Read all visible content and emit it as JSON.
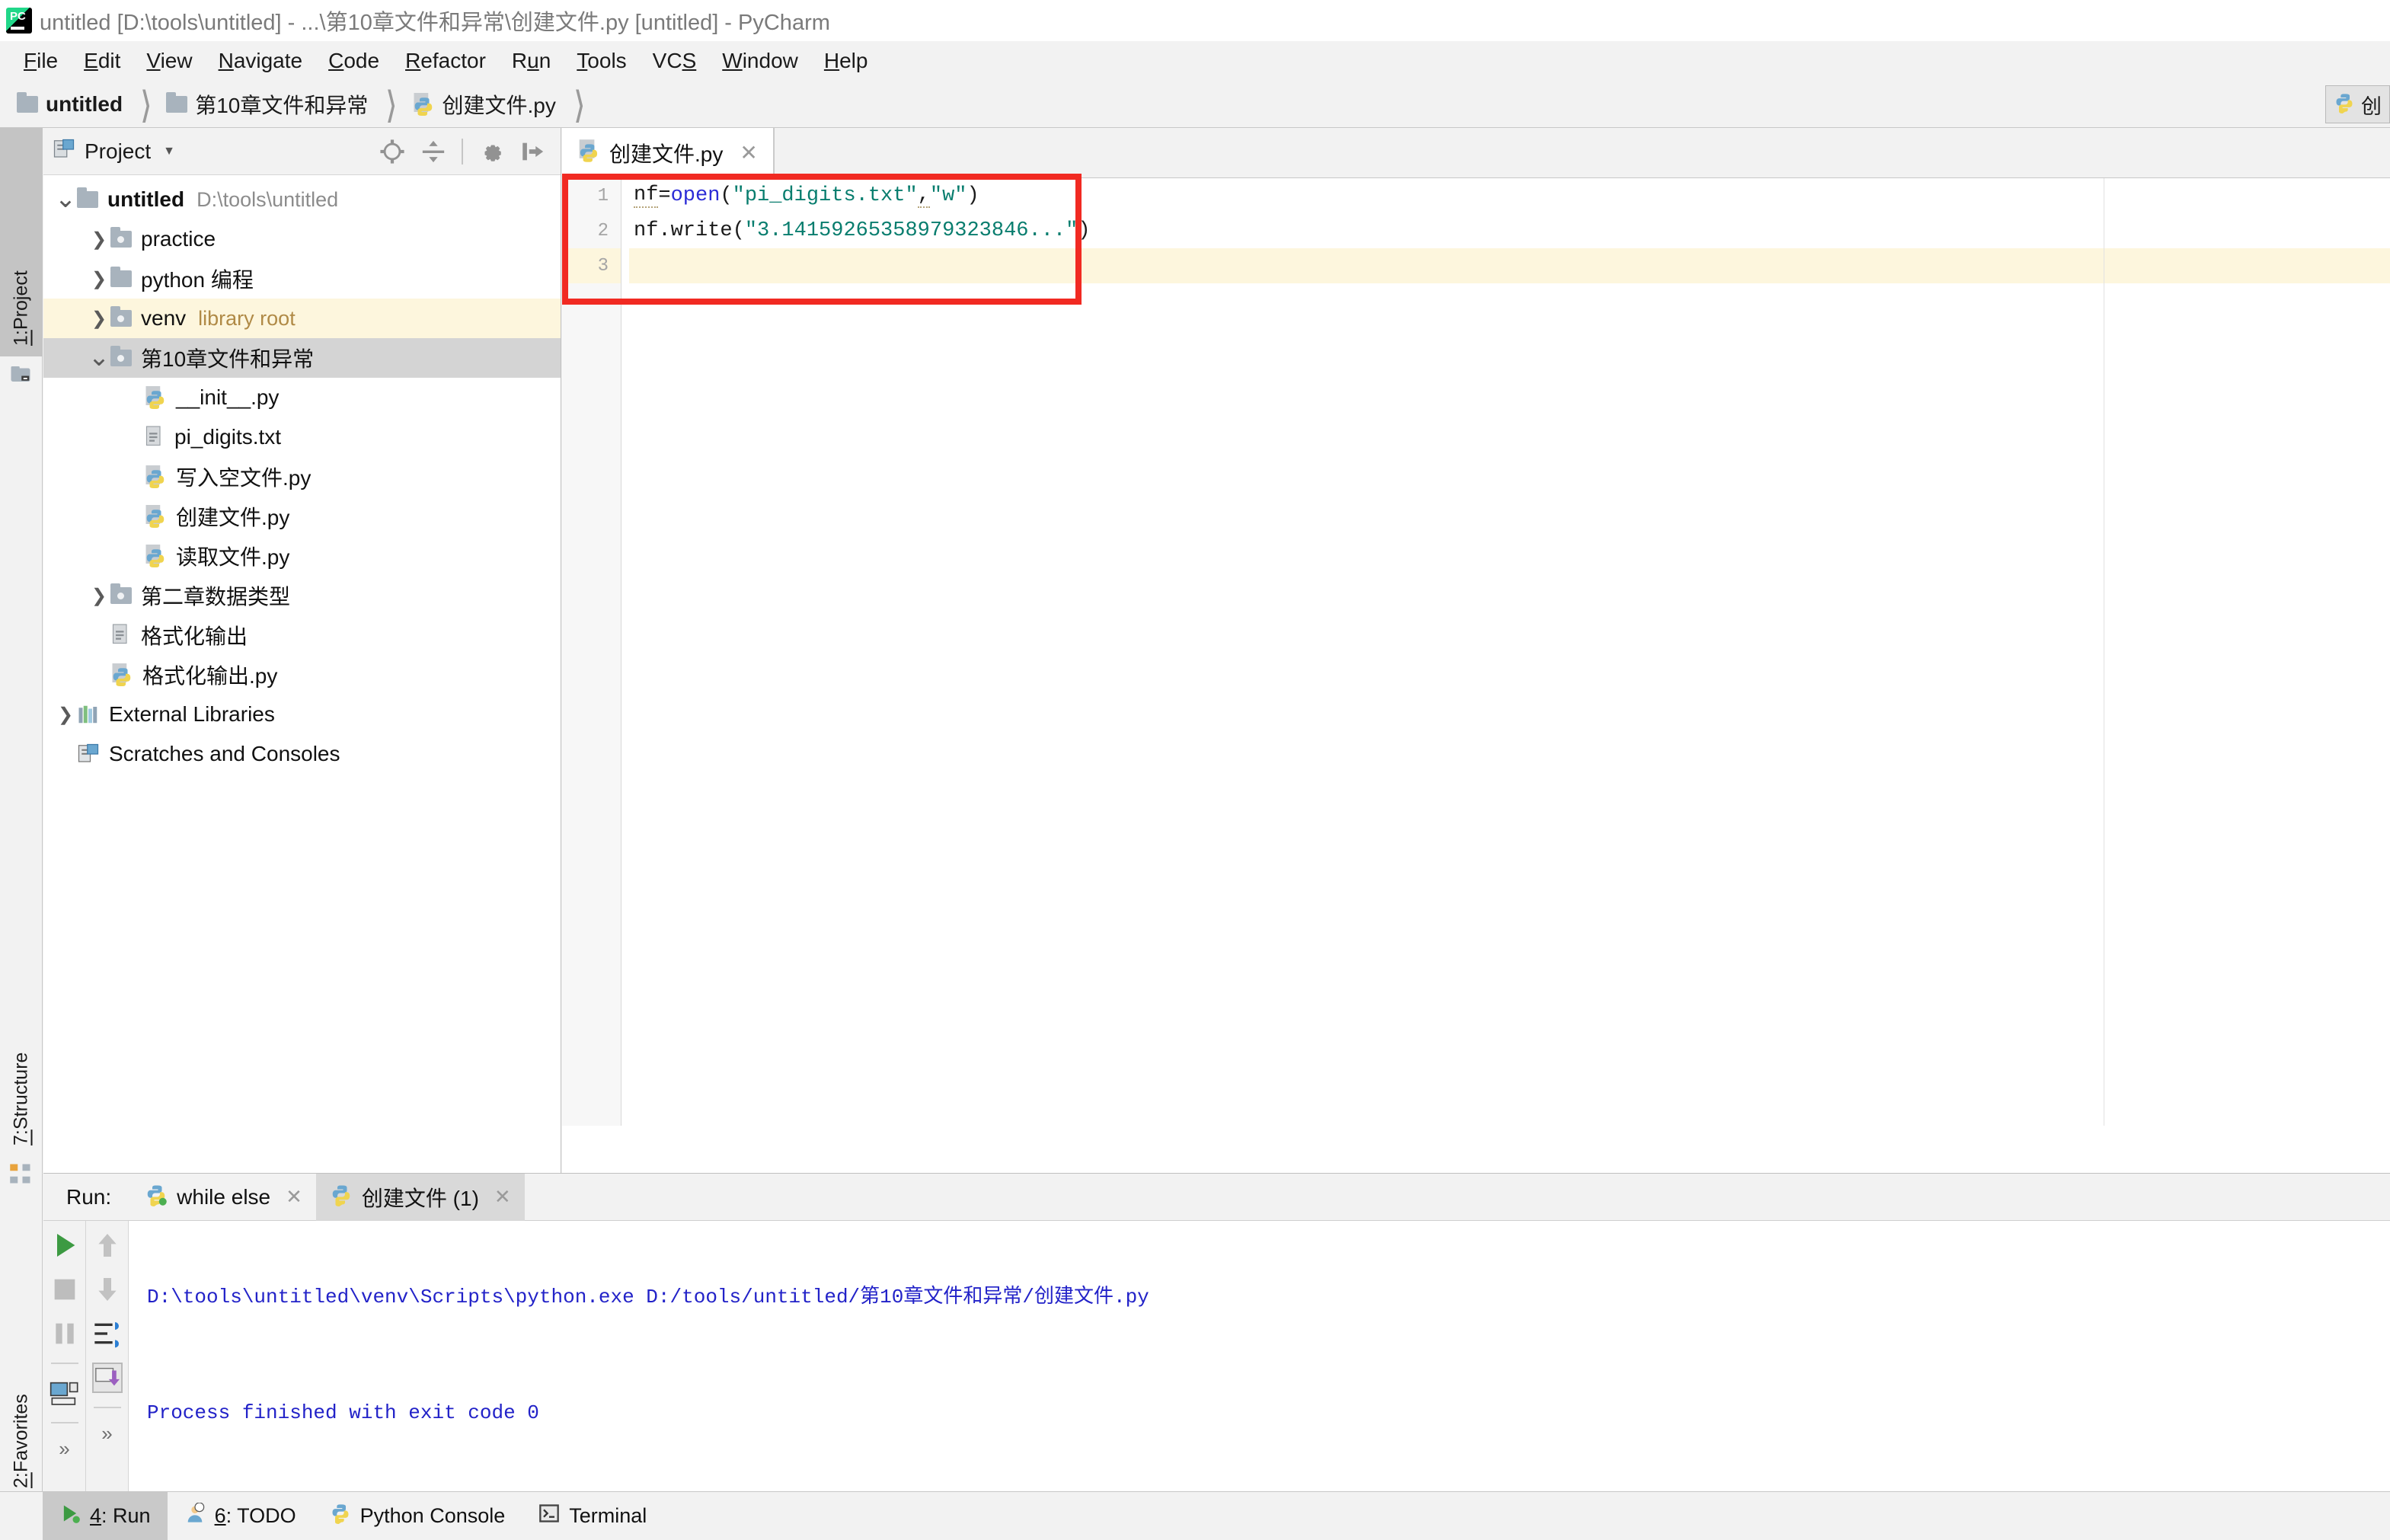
{
  "window": {
    "title": "untitled [D:\\tools\\untitled] - ...\\第10章文件和异常\\创建文件.py [untitled] - PyCharm",
    "logo_icon": "pycharm-logo-icon"
  },
  "menubar": {
    "items": [
      {
        "mnemonic": "F",
        "rest": "ile"
      },
      {
        "mnemonic": "E",
        "rest": "dit"
      },
      {
        "mnemonic": "V",
        "rest": "iew"
      },
      {
        "mnemonic": "N",
        "rest": "avigate"
      },
      {
        "mnemonic": "C",
        "rest": "ode"
      },
      {
        "mnemonic": "R",
        "rest": "efactor"
      },
      {
        "mnemonic": "Ru",
        "rest": "n",
        "under_index": 1
      },
      {
        "mnemonic": "T",
        "rest": "ools"
      },
      {
        "mnemonic": "VCS",
        "rest": ""
      },
      {
        "mnemonic": "W",
        "rest": "indow"
      },
      {
        "mnemonic": "H",
        "rest": "elp"
      }
    ]
  },
  "breadcrumb": {
    "items": [
      {
        "label": "untitled",
        "icon": "folder-icon",
        "bold": true
      },
      {
        "label": "第10章文件和异常",
        "icon": "folder-icon",
        "bold": false
      },
      {
        "label": "创建文件.py",
        "icon": "python-file-icon",
        "bold": false
      }
    ],
    "run_config_label": "创"
  },
  "left_strip": {
    "top_tabs": [
      {
        "label_prefix": "1:",
        "label": " Project",
        "icon": "project-icon",
        "active": true
      }
    ],
    "bottom_tabs": [
      {
        "label_prefix": "7:",
        "label": " Structure",
        "icon": "structure-icon",
        "active": false
      },
      {
        "label_prefix": "2:",
        "label": " Favorites",
        "icon": "star-icon",
        "active": false
      }
    ]
  },
  "project_panel": {
    "title": "Project",
    "header_icon": "project-view-icon",
    "toolbar_icons": [
      "locate-target-icon",
      "collapse-all-icon",
      "gear-icon",
      "hide-panel-icon"
    ],
    "tree": [
      {
        "indent": 0,
        "arrow": "down",
        "icon": "folder-icon",
        "label": "untitled",
        "bold": true,
        "sub": "D:\\tools\\untitled",
        "state": "normal"
      },
      {
        "indent": 1,
        "arrow": "right",
        "icon": "folder-dot-icon",
        "label": "practice",
        "bold": false,
        "sub": "",
        "state": "normal"
      },
      {
        "indent": 1,
        "arrow": "right",
        "icon": "folder-icon",
        "label": "python 编程",
        "bold": false,
        "sub": "",
        "state": "normal"
      },
      {
        "indent": 1,
        "arrow": "right",
        "icon": "folder-dot-icon",
        "label": "venv",
        "bold": false,
        "sub": "library root",
        "state": "highlight"
      },
      {
        "indent": 1,
        "arrow": "down",
        "icon": "folder-dot-icon",
        "label": "第10章文件和异常",
        "bold": false,
        "sub": "",
        "state": "selected"
      },
      {
        "indent": 2,
        "arrow": "none",
        "icon": "python-file-icon",
        "label": "__init__.py",
        "bold": false,
        "sub": "",
        "state": "normal"
      },
      {
        "indent": 2,
        "arrow": "none",
        "icon": "text-file-icon",
        "label": "pi_digits.txt",
        "bold": false,
        "sub": "",
        "state": "normal"
      },
      {
        "indent": 2,
        "arrow": "none",
        "icon": "python-file-icon",
        "label": "写入空文件.py",
        "bold": false,
        "sub": "",
        "state": "normal"
      },
      {
        "indent": 2,
        "arrow": "none",
        "icon": "python-file-icon",
        "label": "创建文件.py",
        "bold": false,
        "sub": "",
        "state": "normal"
      },
      {
        "indent": 2,
        "arrow": "none",
        "icon": "python-file-icon",
        "label": "读取文件.py",
        "bold": false,
        "sub": "",
        "state": "normal"
      },
      {
        "indent": 1,
        "arrow": "right",
        "icon": "folder-dot-icon",
        "label": "第二章数据类型",
        "bold": false,
        "sub": "",
        "state": "normal"
      },
      {
        "indent": 1,
        "arrow": "none",
        "icon": "text-file-icon",
        "label": "格式化输出",
        "bold": false,
        "sub": "",
        "state": "normal"
      },
      {
        "indent": 1,
        "arrow": "none",
        "icon": "python-file-icon",
        "label": "格式化输出.py",
        "bold": false,
        "sub": "",
        "state": "normal"
      },
      {
        "indent": 0,
        "arrow": "right",
        "icon": "libraries-icon",
        "label": "External Libraries",
        "bold": false,
        "sub": "",
        "state": "normal"
      },
      {
        "indent": 0,
        "arrow": "none",
        "icon": "scratches-icon",
        "label": "Scratches and Consoles",
        "bold": false,
        "sub": "",
        "state": "normal"
      }
    ]
  },
  "editor": {
    "tab": {
      "label": "创建文件.py",
      "icon": "python-file-icon",
      "close_icon": "close-icon"
    },
    "lines": [
      {
        "number": "1",
        "current": false,
        "tokens": [
          {
            "text": "nf",
            "type": "plain",
            "squiggle": true
          },
          {
            "text": "=",
            "type": "plain"
          },
          {
            "text": "open",
            "type": "fn"
          },
          {
            "text": "(",
            "type": "paren"
          },
          {
            "text": "\"pi_digits.txt\"",
            "type": "str"
          },
          {
            "text": ",",
            "type": "plain",
            "squiggle": true
          },
          {
            "text": "\"w\"",
            "type": "str"
          },
          {
            "text": ")",
            "type": "paren"
          }
        ]
      },
      {
        "number": "2",
        "current": false,
        "tokens": [
          {
            "text": "nf.write",
            "type": "plain"
          },
          {
            "text": "(",
            "type": "paren"
          },
          {
            "text": "\"3.14159265358979323846...\"",
            "type": "str"
          },
          {
            "text": ")",
            "type": "paren"
          }
        ]
      },
      {
        "number": "3",
        "current": true,
        "tokens": []
      }
    ],
    "annotation": {
      "type": "red-rectangle",
      "color": "#f12a22"
    }
  },
  "run_panel": {
    "label": "Run:",
    "tabs": [
      {
        "label": "while else",
        "icon": "python-run-icon",
        "active": false,
        "close_icon": "close-icon"
      },
      {
        "label": "创建文件 (1)",
        "icon": "python-run-icon",
        "active": true,
        "close_icon": "close-icon"
      }
    ],
    "toolbar_left": [
      "rerun-icon",
      "stop-icon",
      "pause-icon",
      "print-icon",
      "more-icon"
    ],
    "toolbar_right": [
      "up-arrow-icon",
      "down-arrow-icon",
      "soft-wrap-icon",
      "scroll-to-end-icon",
      "more-icon"
    ],
    "console": {
      "command": "D:\\tools\\untitled\\venv\\Scripts\\python.exe D:/tools/untitled/第10章文件和异常/创建文件.py",
      "result": "Process finished with exit code 0"
    }
  },
  "status_bar": {
    "items": [
      {
        "prefix": "4",
        "label": ": Run",
        "icon": "run-icon",
        "active": true
      },
      {
        "prefix": "6",
        "label": ": TODO",
        "icon": "todo-icon",
        "active": false
      },
      {
        "prefix": "",
        "label": "Python Console",
        "icon": "python-console-icon",
        "active": false
      },
      {
        "prefix": "",
        "label": "Terminal",
        "icon": "terminal-icon",
        "active": false
      }
    ]
  },
  "colors": {
    "accent_red": "#f12a22",
    "string_green": "#087d6e",
    "keyword_blue": "#2b2bd6",
    "console_blue": "#2222c8",
    "highlight_yellow": "#fdf6dd",
    "selection_gray": "#d4d4d4"
  }
}
